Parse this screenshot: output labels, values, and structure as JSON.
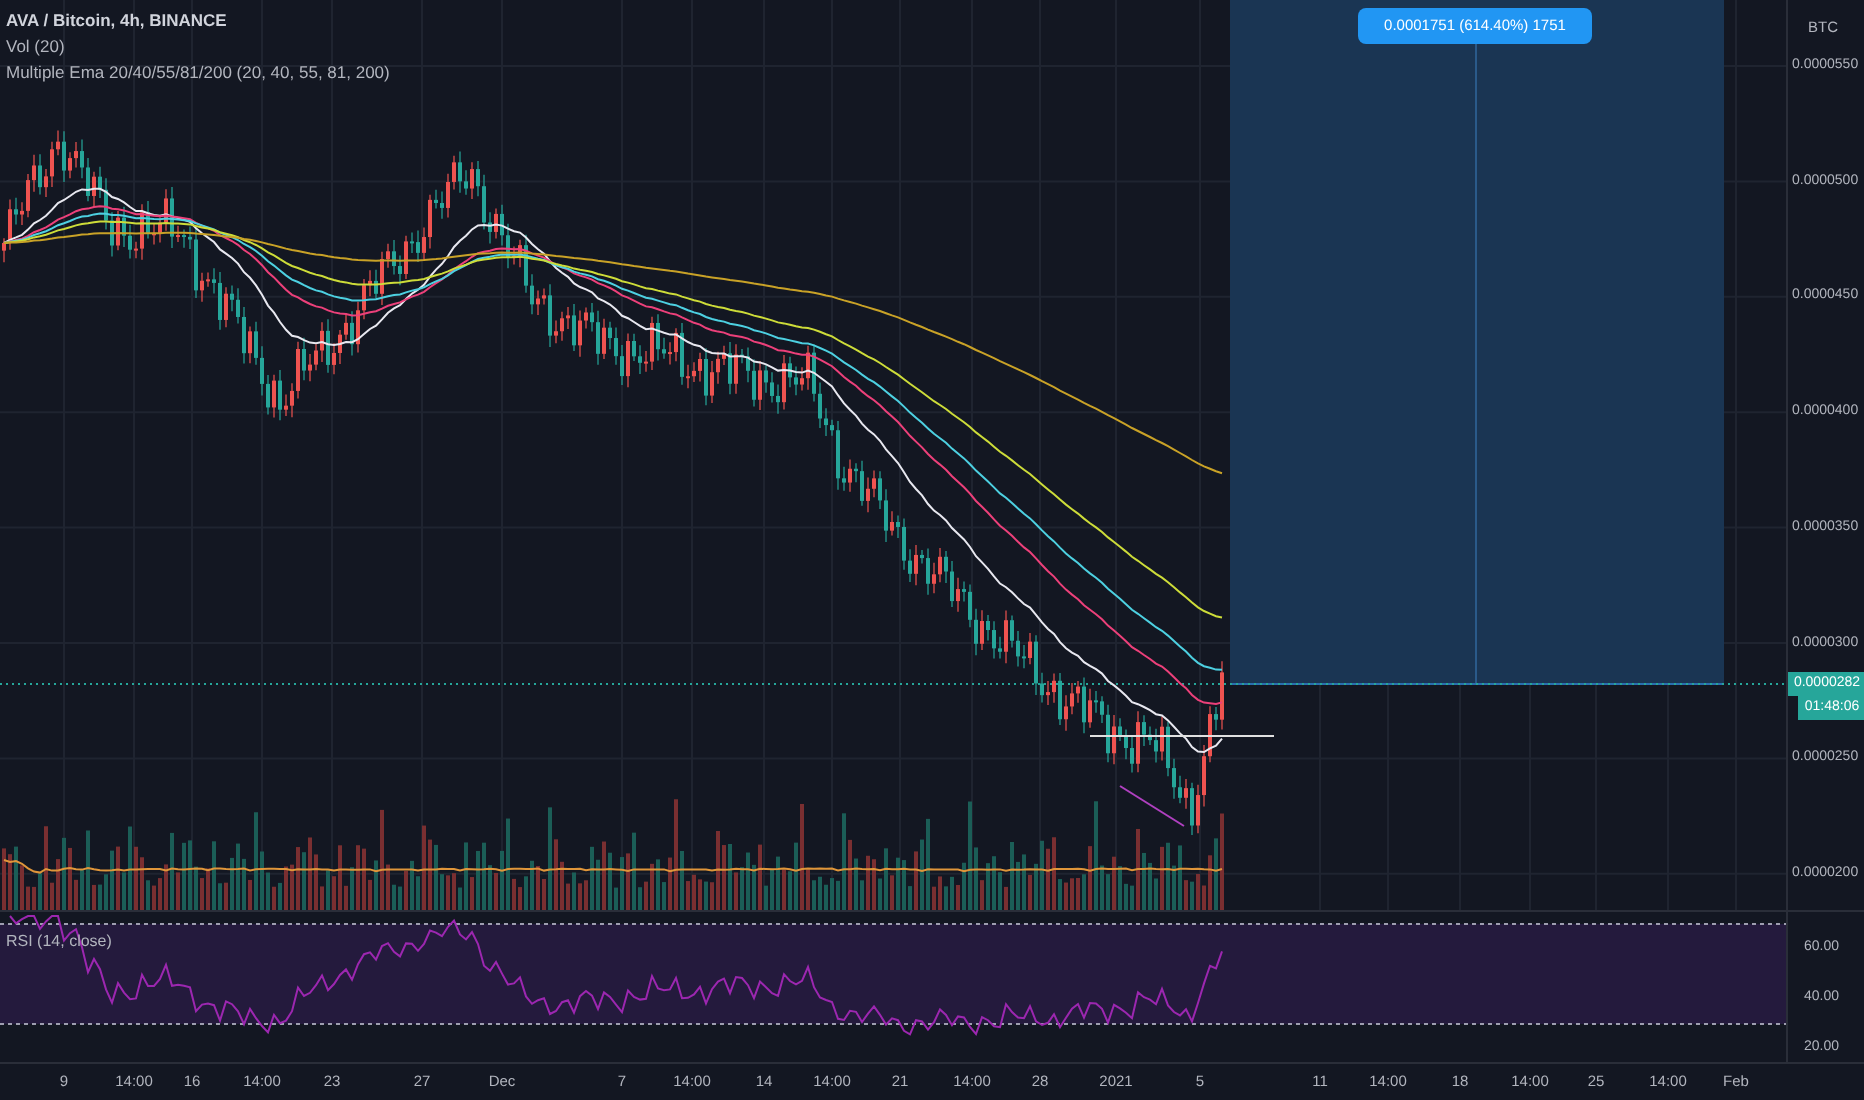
{
  "legend": {
    "title": "AVA / Bitcoin, 4h, BINANCE",
    "indicators": [
      "Vol (20)",
      "Multiple Ema 20/40/55/81/200 (20, 40, 55, 81, 200)"
    ]
  },
  "position_tool": {
    "label": "0.0001751 (614.40%) 1751"
  },
  "price_axis": {
    "currency": "BTC",
    "labels": [
      "0.0000550",
      "0.0000500",
      "0.0000450",
      "0.0000400",
      "0.0000350",
      "0.0000300",
      "0.0000250",
      "0.0000200"
    ],
    "last_price": "0.0000282",
    "countdown": "01:48:06"
  },
  "rsi_pane": {
    "title": "RSI (14, close)",
    "labels": [
      "60.00",
      "40.00",
      "20.00"
    ]
  },
  "time_axis": {
    "labels": [
      "9",
      "14:00",
      "16",
      "14:00",
      "23",
      "27",
      "Dec",
      "7",
      "14:00",
      "14",
      "14:00",
      "21",
      "14:00",
      "28",
      "2021",
      "5",
      "11",
      "14:00",
      "18",
      "14:00",
      "25",
      "14:00",
      "Feb"
    ]
  }
}
